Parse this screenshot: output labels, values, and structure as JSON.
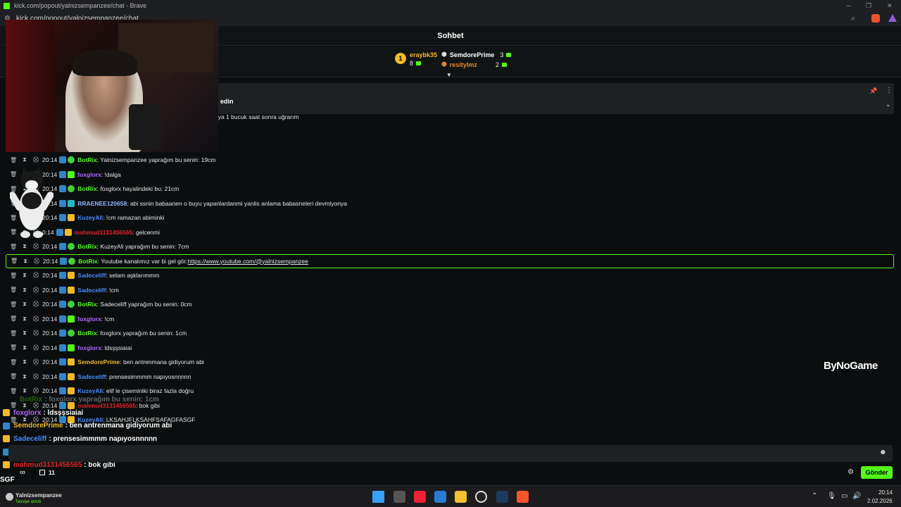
{
  "window": {
    "title": "kick.com/popout/yalnizsempanzee/chat - Brave",
    "url": "kick.com/popout/yalnizsempanzee/chat"
  },
  "chat_header": {
    "title": "Sohbet"
  },
  "leaderboard": {
    "rank": "1",
    "entries": [
      {
        "name": "eraybk35",
        "count": "8"
      },
      {
        "name": "SemdorePrime",
        "count": "3"
      },
      {
        "name": "resitylmz",
        "count": "2"
      }
    ]
  },
  "pinned": {
    "title": "edin",
    "text": "eya 1 bucuk saat sonra uğrarım"
  },
  "messages": [
    {
      "time": "20:14",
      "user": "BotRix",
      "user_color": "#53fc18",
      "text": ": Yalnizsempanzee yaprağım bu senin: 19cm"
    },
    {
      "time": "20:14",
      "user": "foxglorx",
      "user_color": "#b067ff",
      "text": ": !dalga"
    },
    {
      "time": "20:14",
      "user": "BotRix",
      "user_color": "#53fc18",
      "text": ": foxglorx hayalindeki bu: 21cm"
    },
    {
      "time": "20:14",
      "user": "RRAENEE120658",
      "user_color": "#8fb6ff",
      "text": ": abi ssnin babaanen o buyu yapanlardanmi yanlis anlama babasneleri devmiyonya"
    },
    {
      "time": "20:14",
      "user": "KuzeyAli",
      "user_color": "#4a8cff",
      "text": ": !cm ramazan abiminki"
    },
    {
      "time": "0:14",
      "user": "mahmud3131456565",
      "user_color": "#e3242b",
      "text": ": gelcenmi"
    },
    {
      "time": "20:14",
      "user": "BotRix",
      "user_color": "#53fc18",
      "text": ": KuzeyAli yaprağım bu senin: 7cm"
    },
    {
      "time": "20:14",
      "user": "BotRix",
      "user_color": "#53fc18",
      "text": ": Youtube kanalımız var bi gel gör: ",
      "link": "https://www.youtube.com/@yalnizsempanzee"
    },
    {
      "time": "20:14",
      "user": "Sadeceliff",
      "user_color": "#4a8cff",
      "text": ": selam aşklarımmm"
    },
    {
      "time": "20:14",
      "user": "Sadeceliff",
      "user_color": "#4a8cff",
      "text": ": !cm"
    },
    {
      "time": "20:14",
      "user": "BotRix",
      "user_color": "#53fc18",
      "text": ": Sadeceliff yaprağım bu senin: 0cm"
    },
    {
      "time": "20:14",
      "user": "foxglorx",
      "user_color": "#b067ff",
      "text": ": !cm"
    },
    {
      "time": "20:14",
      "user": "BotRix",
      "user_color": "#53fc18",
      "text": ": foxglorx yaprağım bu senin: 1cm"
    },
    {
      "time": "20:14",
      "user": "foxglorx",
      "user_color": "#b067ff",
      "text": ": ldsşşsiaiai"
    },
    {
      "time": "20:14",
      "user": "SemdorePrime",
      "user_color": "#f2b92a",
      "text": ": ben antrenmana gidiyorum abi"
    },
    {
      "time": "20:14",
      "user": "Sadeceliff",
      "user_color": "#4a8cff",
      "text": ": prensesimmmm napıyosnnnnn"
    },
    {
      "time": "20:14",
      "user": "KuzeyAli",
      "user_color": "#4a8cff",
      "text": ": elif le çiseminiki biraz fazla doğru"
    },
    {
      "time": "20:14",
      "user": "mahmud3131456565",
      "user_color": "#e3242b",
      "text": ": bok gibi"
    },
    {
      "time": "20:14",
      "user": "KuzeyAli",
      "user_color": "#4a8cff",
      "text": ": LKSAHJFLKSAHFSAFAGFASGF"
    }
  ],
  "overlay": [
    {
      "user": "BotRix",
      "text": ": foxglorx yaprağım bu senin: 1cm",
      "color": "#53fc18"
    },
    {
      "user": "foxglorx",
      "text": ": ldsşşsiaiai",
      "color": "#b067ff"
    },
    {
      "user": "SemdorePrime",
      "text": ": ben antrenmana gidiyorum abi",
      "color": "#f2b92a"
    },
    {
      "user": "Sadeceliff",
      "text": ": prensesimmmm napıyosnnnnn",
      "color": "#4a8cff"
    },
    {
      "user": "KuzeyAli",
      "text": ": elif le çiseminiki biraz fazla doğru",
      "color": "#4a8cff"
    },
    {
      "user": "mahmud3131456565",
      "text": ": bok gibi",
      "color": "#e3242b"
    }
  ],
  "overlay_extra": {
    "sgf": "SGF",
    "infinity": "∞",
    "count": "11"
  },
  "input": {
    "placeholder": ""
  },
  "send_button": "Gönder",
  "watermark": "ByNoGame",
  "taskbar": {
    "profile_name": "Yalnizsempanzee",
    "profile_sub": "Tavsiye alındı",
    "time": "20:14",
    "date": "2.02.2026"
  }
}
